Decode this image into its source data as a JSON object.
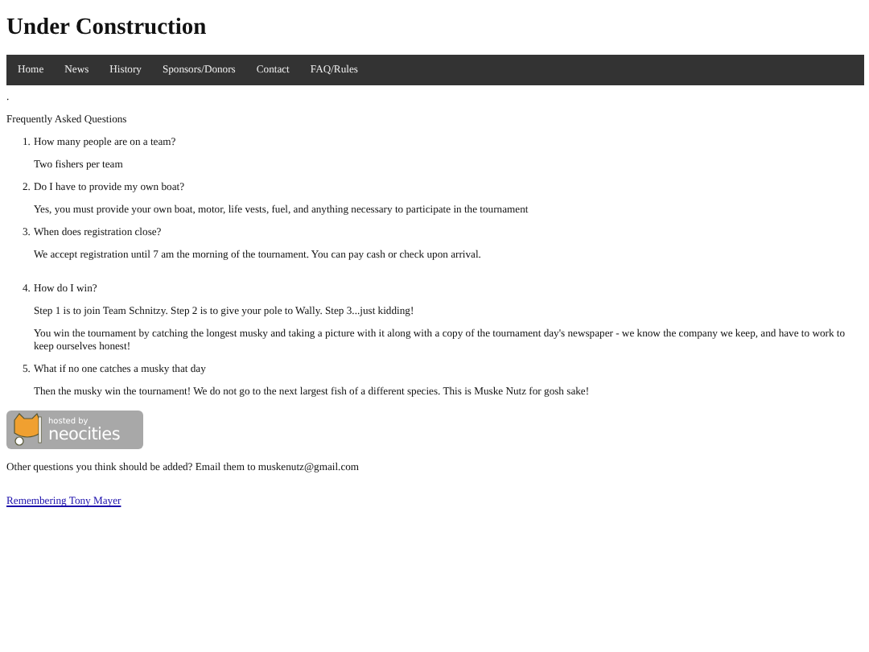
{
  "title": "Under Construction",
  "nav": [
    {
      "label": "Home"
    },
    {
      "label": "News"
    },
    {
      "label": "History"
    },
    {
      "label": "Sponsors/Donors"
    },
    {
      "label": "Contact"
    },
    {
      "label": "FAQ/Rules"
    }
  ],
  "dot": ".",
  "heading": "Frequently Asked Questions",
  "faq": [
    {
      "number": "1.",
      "question": "How many people are on a team?",
      "answers": [
        "Two fishers per team"
      ]
    },
    {
      "number": "2.",
      "question": "Do I have to provide my own boat?",
      "answers": [
        "Yes, you must provide your own boat, motor, life vests, fuel, and anything necessary to participate in the tournament"
      ]
    },
    {
      "number": "3.",
      "question": "When does registration close?",
      "answers": [
        "We accept registration until 7 am the morning of the tournament. You can pay cash or check upon arrival."
      ]
    },
    {
      "number": "4.",
      "question": "How do I win?",
      "answers": [
        "Step 1 is to join Team Schnitzy. Step 2 is to give your pole to Wally. Step 3...just kidding!",
        "You win the tournament by catching the longest musky and taking a picture with it along with a copy of the tournament day's newspaper - we know the company we keep, and have to work to keep ourselves honest!"
      ]
    },
    {
      "number": "5.",
      "question": "What if no one catches a musky that day",
      "answers": [
        "Then the musky win the tournament! We do not go to the next largest fish of a different species. This is Muske Nutz for gosh sake!"
      ]
    }
  ],
  "badge": {
    "small": "hosted by",
    "big": "neocities"
  },
  "contact": "Other questions you think should be added? Email them to muskenutz@gmail.com",
  "link": "Remembering Tony Mayer"
}
